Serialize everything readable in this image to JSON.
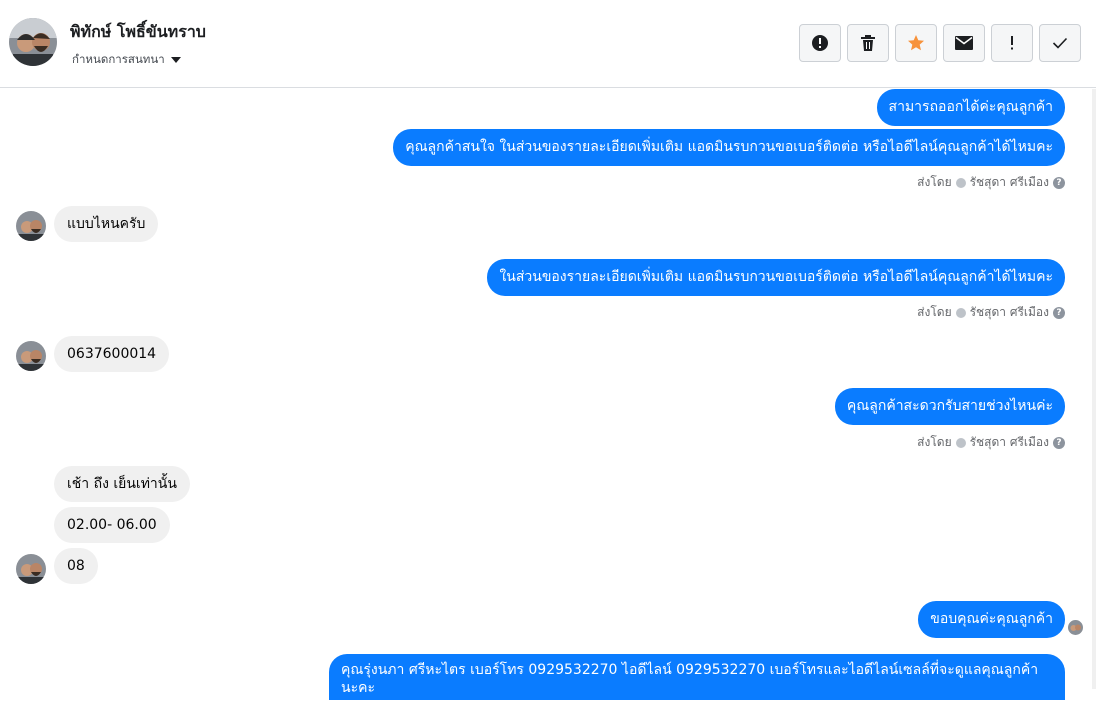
{
  "header": {
    "contact_name": "พิทักษ์ โพธิ์ขันทราบ",
    "assign_label": "กำหนดการสนทนา"
  },
  "toolbar": {
    "buttons": [
      {
        "name": "report-spam-button",
        "icon": "alert-circle-icon"
      },
      {
        "name": "delete-button",
        "icon": "trash-icon"
      },
      {
        "name": "star-button",
        "icon": "star-icon",
        "color": "#f7923b"
      },
      {
        "name": "mark-unread-button",
        "icon": "envelope-icon"
      },
      {
        "name": "follow-up-button",
        "icon": "exclamation-icon"
      },
      {
        "name": "mark-done-button",
        "icon": "check-icon"
      }
    ]
  },
  "colors": {
    "outgoing_bubble": "#0a7cff",
    "incoming_bubble": "#f0f0f0",
    "meta_text": "#65676b"
  },
  "messages": {
    "m1": "สามารถออกได้ค่ะคุณลูกค้า",
    "m2": "คุณลูกค้าสนใจ ในส่วนของรายละเอียดเพิ่มเติม แอดมินรบกวนขอเบอร์ติดต่อ หรือไอดีไลน์คุณลูกค้าได้ไหมคะ",
    "m3": "แบบไหนครับ",
    "m4": "ในส่วนของรายละเอียดเพิ่มเติม แอดมินรบกวนขอเบอร์ติดต่อ หรือไอดีไลน์คุณลูกค้าได้ไหมคะ",
    "m5": "0637600014",
    "m6": "คุณลูกค้าสะดวกรับสายช่วงไหนค่ะ",
    "m7": "เช้า ถึง เย็นเท่านั้น",
    "m8": "02.00- 06.00",
    "m9": "08",
    "m10": "ขอบคุณค่ะคุณลูกค้า",
    "m11": "คุณรุ่งนภา ศรีหะไตร       เบอร์โทร 0929532270  ไอดีไลน์ 0929532270   เบอร์โทรและไอดีไลน์เซลล์ที่จะดูแลคุณลูกค้านะคะ"
  },
  "sent_by": {
    "prefix": "ส่งโดย",
    "agent": "รัชสุดา ศรีเมือง"
  }
}
